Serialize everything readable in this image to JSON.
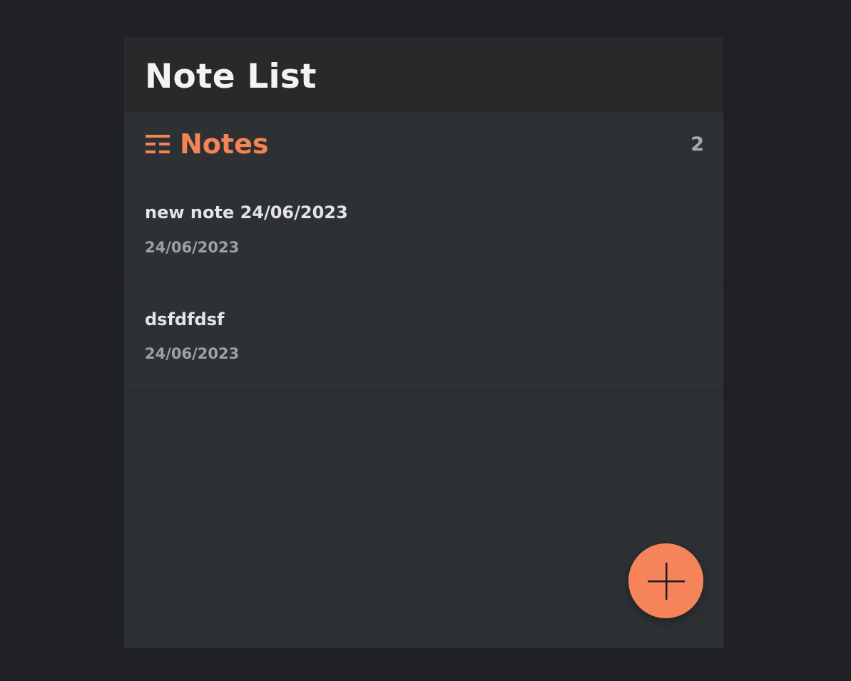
{
  "header": {
    "title": "Note List"
  },
  "section": {
    "icon": "list-icon",
    "title": "Notes",
    "count": "2"
  },
  "notes": [
    {
      "title": "new note 24/06/2023",
      "date": "24/06/2023"
    },
    {
      "title": "dsfdfdsf",
      "date": "24/06/2023"
    }
  ],
  "fab": {
    "icon": "plus-icon"
  },
  "colors": {
    "background": "#202124",
    "panel": "#2e3134",
    "header": "#28292b",
    "accent": "#f5845a",
    "title_text": "#f3f3f3",
    "secondary_text": "#9fa0a1"
  }
}
